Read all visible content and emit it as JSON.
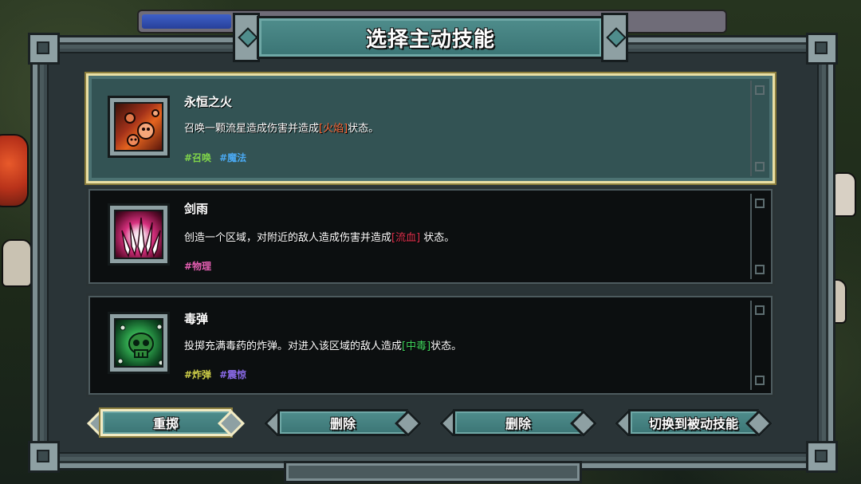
{
  "title": "选择主动技能",
  "skills": [
    {
      "name": "永恒之火",
      "desc_before": "召唤一颗流星造成伤害并造成",
      "keyword": "[火焰]",
      "desc_after": "状态。",
      "tags": [
        "#召唤",
        "#魔法"
      ],
      "icon": "flaming-meteor-icon",
      "selected": true
    },
    {
      "name": "剑雨",
      "desc_before": "创造一个区域，对附近的敌人造成伤害并造成",
      "keyword": "[流血]",
      "desc_after": " 状态。",
      "tags": [
        "#物理"
      ],
      "icon": "sword-rain-icon",
      "selected": false
    },
    {
      "name": "毒弹",
      "desc_before": "投掷充满毒药的炸弹。对进入该区域的敌人造成",
      "keyword": "[中毒]",
      "desc_after": "状态。",
      "tags": [
        "#炸弹",
        "#震惊"
      ],
      "icon": "poison-skull-icon",
      "selected": false
    }
  ],
  "buttons": {
    "reroll": "重掷",
    "delete1": "删除",
    "delete2": "删除",
    "switch": "切换到被动技能"
  },
  "colors": {
    "panel_teal": "#4f8d8c",
    "keyword_fire": "#ff6a3a",
    "keyword_bleed": "#e0324e",
    "keyword_poison": "#3fd25c"
  }
}
